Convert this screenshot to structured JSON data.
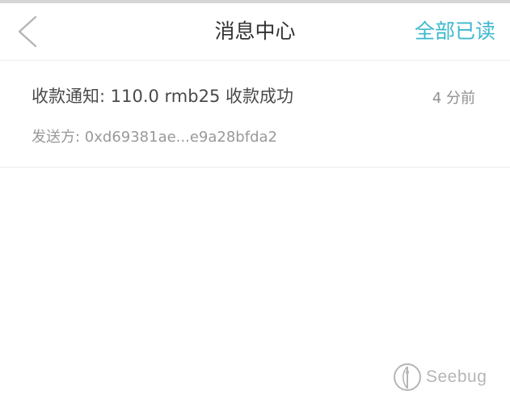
{
  "nav": {
    "back_icon": "chevron-left-icon",
    "title": "消息中心",
    "mark_all_read": "全部已读",
    "accent_color": "#3cb9cf"
  },
  "messages": [
    {
      "title": "收款通知: 110.0 rmb25 收款成功",
      "time": "4 分前",
      "sender": "发送方: 0xd69381ae...e9a28bfda2"
    }
  ],
  "watermark": {
    "text": "Seebug",
    "icon": "seebug-logo-icon"
  }
}
